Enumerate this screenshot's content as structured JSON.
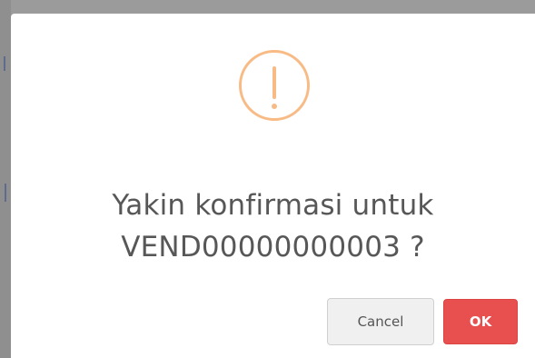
{
  "dialog": {
    "icon": "warning-exclamation-icon",
    "message_line1": "Yakin konfirmasi untuk",
    "message_line2": "VEND00000000003 ?",
    "cancel_label": "Cancel",
    "ok_label": "OK"
  },
  "colors": {
    "warning_accent": "#f8bb86",
    "ok_button": "#e8504f",
    "cancel_button": "#f0f0f0",
    "message_text": "#575757"
  }
}
